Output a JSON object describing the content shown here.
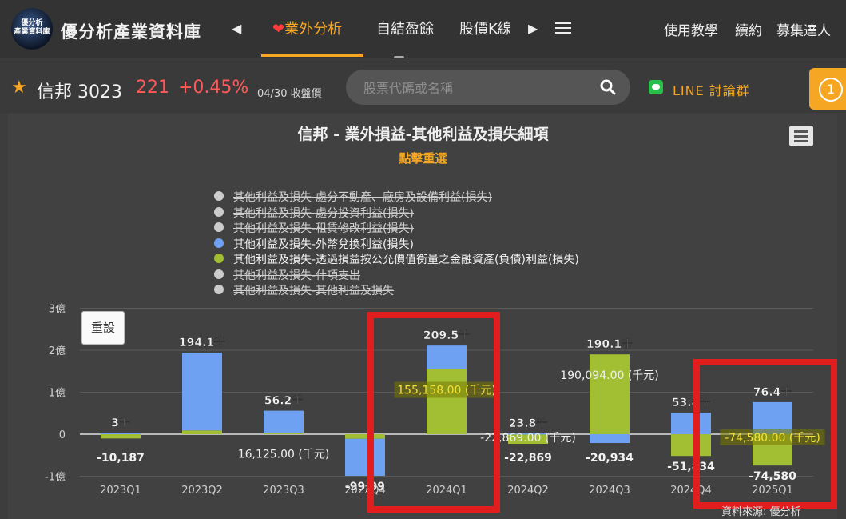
{
  "header": {
    "logo_text": "優分析\n產業資料庫",
    "site_title": "優分析產業資料庫",
    "tabs": [
      {
        "label": "業外分析",
        "active": true
      },
      {
        "label": "自結盈餘",
        "active": false
      },
      {
        "label": "股價K線",
        "active": false
      }
    ],
    "links": [
      "使用教學",
      "續約",
      "募集達人"
    ]
  },
  "stock": {
    "name_code": "信邦 3023",
    "price": "221",
    "change": "+0.45%",
    "date_label": "04/30 收盤價",
    "search_placeholder": "股票代碼或名稱",
    "line_label": "LINE 討論群",
    "notification_count": "1"
  },
  "chart_data": {
    "type": "bar",
    "stacked": true,
    "title": "信邦 - 業外損益-其他利益及損失細項",
    "subtitle": "點擊重選",
    "legend": [
      {
        "label": "其他利益及損失-處分不動產、廠房及設備利益(損失)",
        "enabled": false
      },
      {
        "label": "其他利益及損失-處分投資利益(損失)",
        "enabled": false
      },
      {
        "label": "其他利益及損失-租賃修改利益(損失)",
        "enabled": false
      },
      {
        "label": "其他利益及損失-外幣兌換利益(損失)",
        "enabled": true,
        "color": "#6fa1f2"
      },
      {
        "label": "其他利益及損失-透過損益按公允價值衡量之金融資產(負債)利益(損失)",
        "enabled": true,
        "color": "#a2be33"
      },
      {
        "label": "其他利益及損失-什項支出",
        "enabled": false
      },
      {
        "label": "其他利益及損失-其他利益及損失",
        "enabled": false
      }
    ],
    "categories": [
      "2023Q1",
      "2023Q2",
      "2023Q3",
      "2023Q4",
      "2024Q1",
      "2024Q2",
      "2024Q3",
      "2024Q4",
      "2025Q1"
    ],
    "series": [
      {
        "name": "其他利益及損失-外幣兌換利益(損失)",
        "color": "#6fa1f2",
        "values": [
          3000,
          185000,
          53000,
          -88000,
          56000,
          2000,
          -21000,
          51000,
          76400
        ]
      },
      {
        "name": "其他利益及損失-透過損益按公允價值衡量之金融資產(負債)利益(損失)",
        "color": "#a2be33",
        "values": [
          -10187,
          9000,
          3000,
          -11000,
          155158,
          -22869,
          190094,
          -51834,
          -74580
        ]
      }
    ],
    "top_labels": [
      "3千",
      "194.1千",
      "56.2千",
      "",
      "209.5千",
      "23.8千",
      "190.1千",
      "53.8千",
      "76.4千"
    ],
    "bottom_labels": [
      "-10,187",
      "",
      "",
      "-99,99",
      "",
      "-22,869",
      "-20,934",
      "-51,834",
      "-74,580"
    ],
    "tooltips": [
      {
        "index": 2,
        "text": "16,125.00 (千元)"
      },
      {
        "index": 4,
        "text": "155,158.00 (千元)"
      },
      {
        "index": 5,
        "text": "-22,869.00 (千元)"
      },
      {
        "index": 6,
        "text": "190,094.00 (千元)"
      },
      {
        "index": 8,
        "text": "-74,580.00 (千元)"
      }
    ],
    "y_ticks": [
      "3億",
      "2億",
      "1億",
      "0",
      "-1億"
    ],
    "y_tick_values": [
      300000,
      200000,
      100000,
      0,
      -100000
    ],
    "ylim": [
      -100000,
      300000
    ],
    "reset_label": "重設",
    "source": "資料來源: 優分析",
    "highlighted_categories": [
      "2024Q1",
      "2025Q1"
    ],
    "highlight_color": "#e11d1d"
  }
}
